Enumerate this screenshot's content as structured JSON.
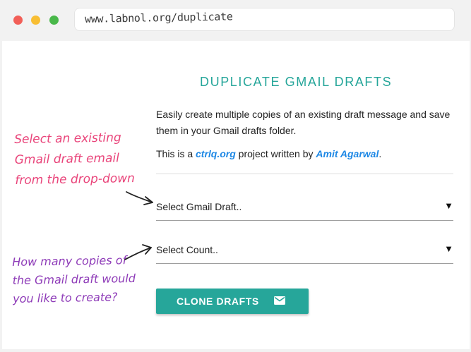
{
  "browser": {
    "url": "www.labnol.org/duplicate",
    "colors": {
      "close": "#f25f58",
      "minimize": "#f8be33",
      "zoom": "#49b84a"
    }
  },
  "page": {
    "title": "DUPLICATE GMAIL DRAFTS",
    "description": "Easily create multiple copies of an existing draft message and save them in your Gmail drafts folder.",
    "credit_prefix": "This is a ",
    "credit_link1": "ctrlq.org",
    "credit_middle": " project written by ",
    "credit_link2": "Amit Agarwal",
    "credit_suffix": ".",
    "select_draft": {
      "value": "Select Gmail Draft..",
      "caret": "▼"
    },
    "select_count": {
      "value": "Select Count..",
      "caret": "▼"
    },
    "button": {
      "label": "CLONE DRAFTS",
      "icon": "mail-icon"
    },
    "accent_color": "#26a69a"
  },
  "annotations": {
    "note1": [
      "Select an existing",
      "Gmail draft email",
      "from the drop-down"
    ],
    "note2": [
      "How many copies of",
      "the Gmail draft would",
      "you like to create?"
    ],
    "note1_color": "#e9447a",
    "note2_color": "#8e3bb8"
  }
}
